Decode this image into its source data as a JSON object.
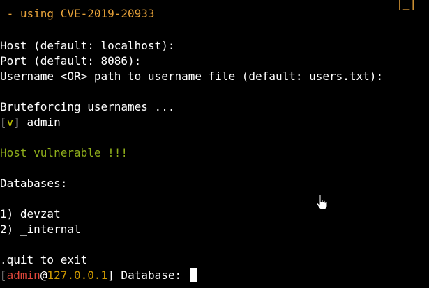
{
  "terminal": {
    "corner_art": "|_|",
    "cve_line": " - using CVE-2019-20933",
    "host_prompt": "Host (default: localhost):",
    "port_prompt": "Port (default: 8086):",
    "username_prompt": "Username <OR> path to username file (default: users.txt):",
    "bruteforcing": "Bruteforcing usernames ...",
    "found_bracket_open": "[",
    "found_mark": "v",
    "found_bracket_close": "]",
    "found_user": " admin",
    "vulnerable": "Host vulnerable !!!",
    "databases_header": "Databases:",
    "databases": [
      "1) devzat",
      "2) _internal"
    ],
    "quit_hint": ".quit to exit",
    "prompt": {
      "bracket_open": "[",
      "user": "admin",
      "at": "@",
      "host": "127.0.0.1",
      "bracket_close": "]",
      "label": " Database: "
    }
  },
  "colors": {
    "background": "#000000",
    "text": "#ffffff",
    "cve_line": "#e8a33a",
    "vulnerable": "#8fae1b",
    "found_mark": "#c4c800",
    "prompt_user": "#e0463a",
    "prompt_host": "#d19a00"
  },
  "icons": {
    "mouse_pointer": "hand-pointer-icon"
  }
}
